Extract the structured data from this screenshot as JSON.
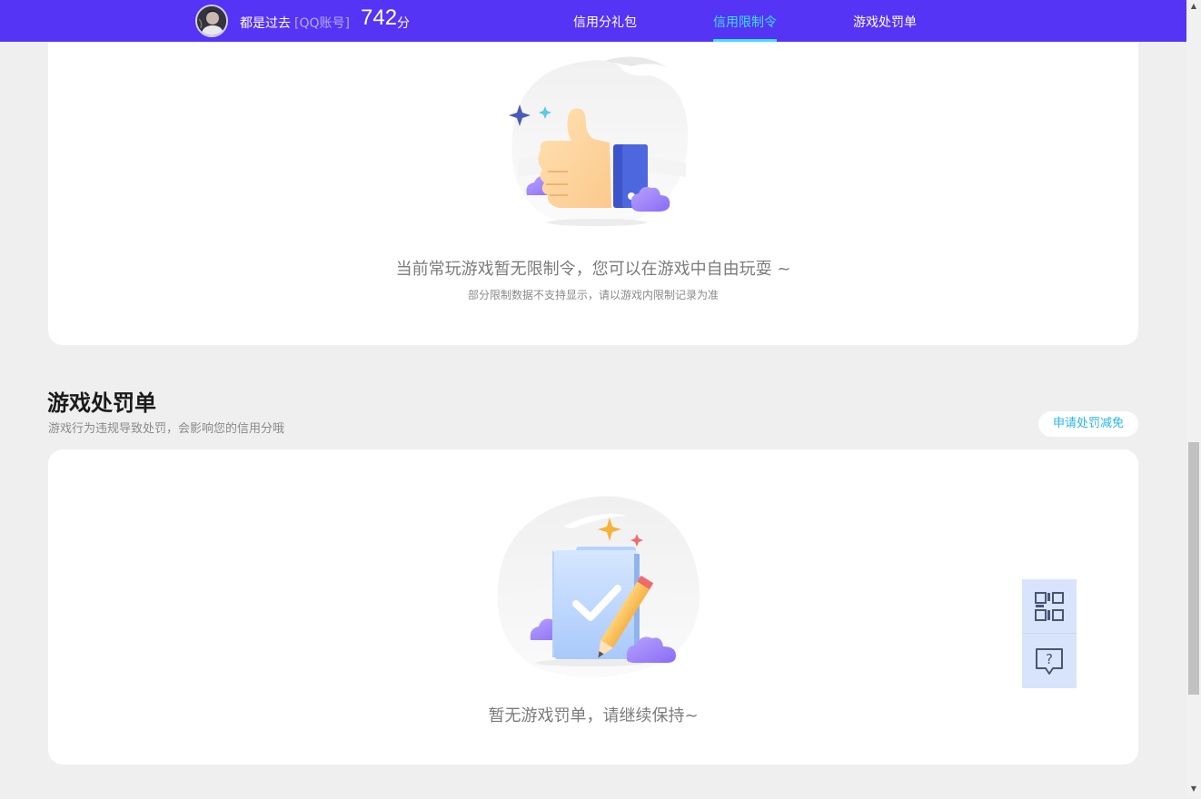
{
  "header": {
    "user_name": "都是过去",
    "account_type": "[QQ账号]",
    "score": "742",
    "score_unit": "分",
    "tabs": [
      {
        "label": "信用分礼包",
        "active": false
      },
      {
        "label": "信用限制令",
        "active": true
      },
      {
        "label": "游戏处罚单",
        "active": false
      }
    ],
    "accent_color": "#5534f5",
    "active_tab_color": "#3ee0ff"
  },
  "restriction": {
    "empty_text": "当前常玩游戏暂无限制令，您可以在游戏中自由玩耍 ~",
    "note": "部分限制数据不支持显示，请以游戏内限制记录为准",
    "illustration": "thumbs-up-illustration"
  },
  "penalty": {
    "title": "游戏处罚单",
    "subtitle": "游戏行为违规导致处罚，会影响您的信用分哦",
    "appeal_button": "申请处罚减免",
    "empty_text": "暂无游戏罚单，请继续保持~",
    "illustration": "document-check-illustration"
  },
  "floating_tools": [
    {
      "icon": "qr-code-icon"
    },
    {
      "icon": "help-chat-icon"
    }
  ]
}
